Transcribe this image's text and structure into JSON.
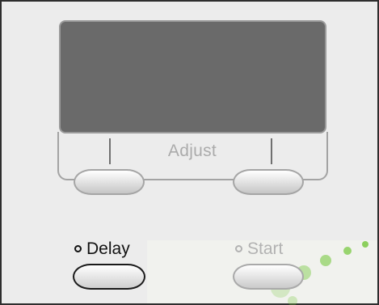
{
  "display": {
    "adjust_label": "Adjust"
  },
  "controls": {
    "delay_label": "Delay",
    "start_label": "Start"
  },
  "colors": {
    "screen": "#6a6a6a",
    "panel": "#ececec",
    "accent_dots": "#7ac943"
  },
  "icons": {
    "delay_indicator": "led-ring-icon",
    "start_indicator": "led-ring-icon"
  }
}
